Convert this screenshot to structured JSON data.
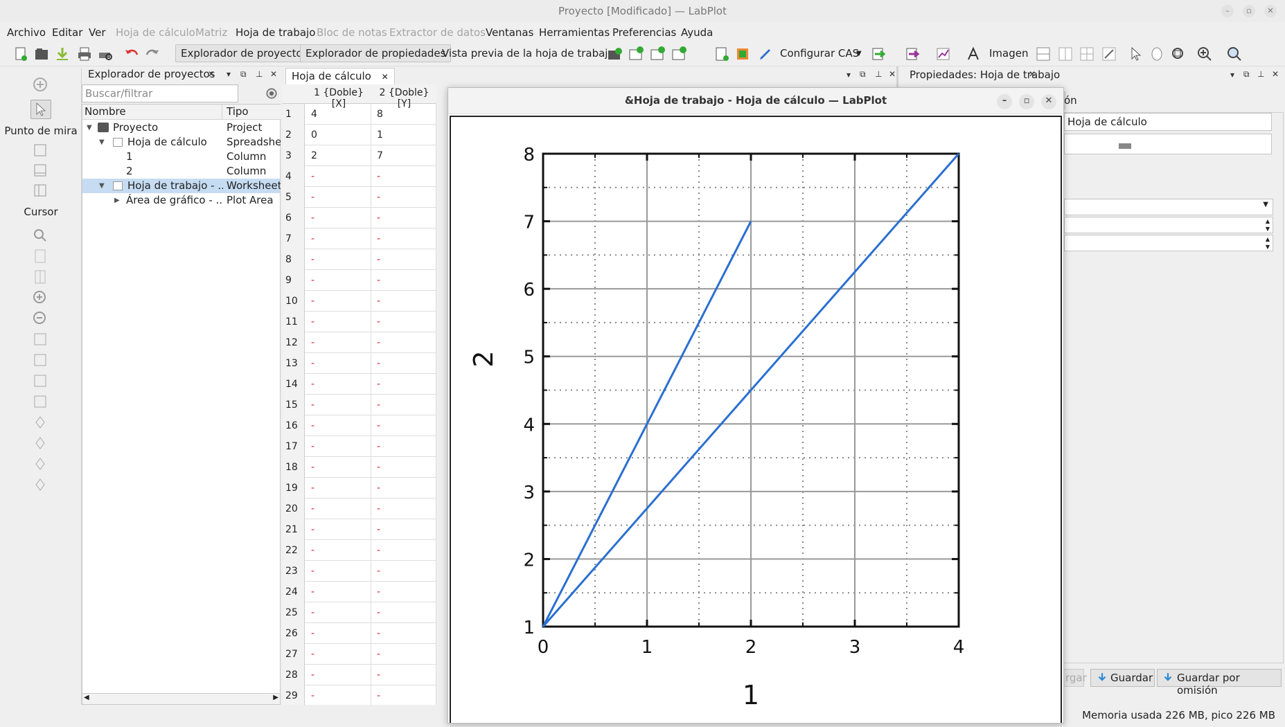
{
  "window": {
    "title": "Proyecto    [Modificado] — LabPlot"
  },
  "menu": [
    "Archivo",
    "Editar",
    "Ver",
    "Hoja de cálculo",
    "Matriz",
    "Hoja de trabajo",
    "Bloc de notas",
    "Extractor de datos",
    "Ventanas",
    "Herramientas",
    "Preferencias",
    "Ayuda"
  ],
  "toolbar": {
    "project_explorer": "Explorador de proyectos",
    "property_explorer": "Explorador de propiedades",
    "preview": "Vista previa de la hoja de trabajo",
    "cas": "Configurar CAS",
    "image": "Imagen"
  },
  "leftbar": {
    "crosshair": "Punto de mira",
    "cursor": "Cursor"
  },
  "explorer": {
    "title": "Explorador de proyectos",
    "search_placeholder": "Buscar/filtrar",
    "col_name": "Nombre",
    "col_type": "Tipo",
    "rows": [
      {
        "name": "Proyecto",
        "type": "Project"
      },
      {
        "name": "Hoja de cálculo",
        "type": "Spreadsheet"
      },
      {
        "name": "1",
        "type": "Column"
      },
      {
        "name": "2",
        "type": "Column"
      },
      {
        "name": "Hoja de trabajo - ...",
        "type": "Worksheet"
      },
      {
        "name": "Área de gráfico - ...",
        "type": "Plot Area"
      }
    ]
  },
  "spreadsheet": {
    "tab": "Hoja de cálculo",
    "col1": "1 {Doble} [X]",
    "col2": "2 {Doble} [Y]",
    "rows": [
      "1",
      "2",
      "3",
      "4",
      "5",
      "6",
      "7",
      "8",
      "9",
      "10",
      "11",
      "12",
      "13",
      "14",
      "15",
      "16",
      "17",
      "18",
      "19",
      "20",
      "21",
      "22",
      "23",
      "24",
      "25",
      "26",
      "27",
      "28",
      "29"
    ],
    "x_values": [
      "4",
      "0",
      "2"
    ],
    "y_values": [
      "8",
      "1",
      "7"
    ],
    "empty": "-"
  },
  "properties": {
    "title": "Propiedades: Hoja de trabajo",
    "tab_partial": "ón",
    "name_value": "Hoja de cálculo",
    "load_partial": "rgar",
    "save": "Guardar",
    "save_default": "Guardar por omisión"
  },
  "status": {
    "memory": "Memoria usada 226 MB, pico 226 MB"
  },
  "subwindow": {
    "title": "&Hoja de trabajo - Hoja de cálculo — LabPlot"
  },
  "chart_data": {
    "type": "line",
    "xlabel": "1",
    "ylabel": "2",
    "xlim": [
      0,
      4
    ],
    "ylim": [
      1,
      8
    ],
    "xticks": [
      0,
      1,
      2,
      3,
      4
    ],
    "yticks": [
      1,
      2,
      3,
      4,
      5,
      6,
      7,
      8
    ],
    "grid": true,
    "line_color": "#2a6fd1",
    "x": [
      4,
      0,
      2
    ],
    "y": [
      8,
      1,
      7
    ]
  }
}
